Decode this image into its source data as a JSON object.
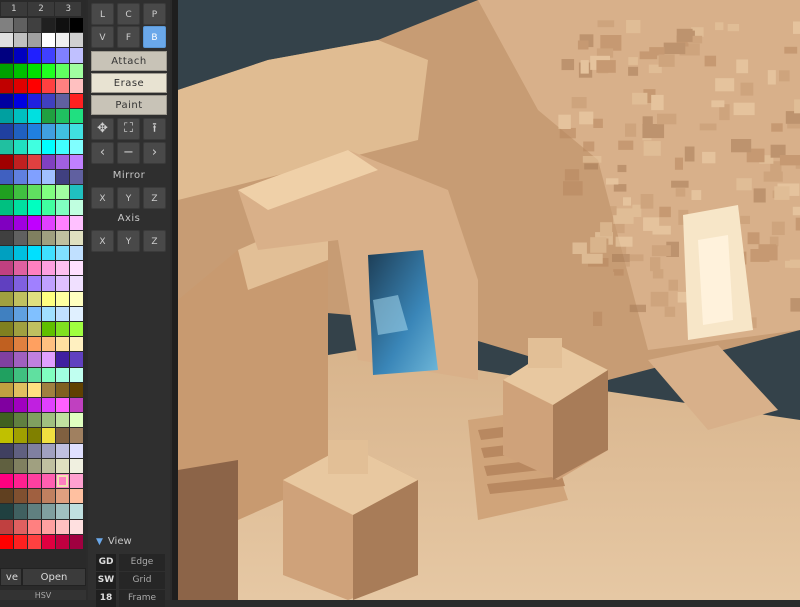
{
  "palette": {
    "tabs": [
      "1",
      "2",
      "3"
    ],
    "actions": {
      "save_label": "ve",
      "open_label": "Open"
    },
    "mode_label": "HSV",
    "columns": 6,
    "rows": 35,
    "selected_index": 184,
    "colors": [
      "#808080",
      "#606060",
      "#404040",
      "#202020",
      "#101010",
      "#000000",
      "#e0e0e0",
      "#c0c0c0",
      "#a0a0a0",
      "#ffffff",
      "#f0f0f0",
      "#d0d0d0",
      "#000080",
      "#0000c0",
      "#2020ff",
      "#4040ff",
      "#8080ff",
      "#c0c0ff",
      "#00a000",
      "#00c000",
      "#00e000",
      "#20ff20",
      "#60ff60",
      "#a0ffa0",
      "#c00000",
      "#e00000",
      "#ff0000",
      "#ff4040",
      "#ff8080",
      "#ffc0c0",
      "#0000a0",
      "#0000e0",
      "#2020e0",
      "#4040c0",
      "#6060a0",
      "#ff2020",
      "#00a0a0",
      "#00c0c0",
      "#00e0e0",
      "#20a040",
      "#20c060",
      "#20e080",
      "#2040a0",
      "#2060c0",
      "#2080e0",
      "#40a0e0",
      "#40c0e0",
      "#40e0e0",
      "#20c0a0",
      "#20e0c0",
      "#40ffe0",
      "#00ffff",
      "#40ffff",
      "#80ffff",
      "#a00000",
      "#c02020",
      "#e04040",
      "#8040c0",
      "#a060e0",
      "#c080ff",
      "#4060c0",
      "#6080e0",
      "#80a0ff",
      "#a0c0ff",
      "#404080",
      "#6060a0",
      "#20a020",
      "#40c040",
      "#60e060",
      "#80ff80",
      "#a0ffa0",
      "#20c0c0",
      "#00c080",
      "#00e0a0",
      "#00ffc0",
      "#40ffa0",
      "#80ffc0",
      "#c0ffe0",
      "#8000c0",
      "#a000e0",
      "#c000ff",
      "#e040ff",
      "#ff80ff",
      "#ffc0ff",
      "#404040",
      "#606060",
      "#808060",
      "#a0a080",
      "#c0c0a0",
      "#e0e0c0",
      "#00a0c0",
      "#00c0e0",
      "#00e0ff",
      "#40e0ff",
      "#80e0ff",
      "#c0e0ff",
      "#c04080",
      "#e060a0",
      "#ff80c0",
      "#ffa0e0",
      "#ffc0f0",
      "#ffe0ff",
      "#6040c0",
      "#8060e0",
      "#a080ff",
      "#c0a0ff",
      "#e0c0ff",
      "#f0e0ff",
      "#a0a040",
      "#c0c060",
      "#e0e080",
      "#ffff80",
      "#ffffa0",
      "#ffffc0",
      "#4080c0",
      "#60a0e0",
      "#80c0ff",
      "#a0e0ff",
      "#c0e0ff",
      "#e0f0ff",
      "#808020",
      "#a0a040",
      "#c0c060",
      "#60c000",
      "#80e020",
      "#a0ff40",
      "#c06020",
      "#e08040",
      "#ffa060",
      "#ffc080",
      "#ffe0a0",
      "#fff0c0",
      "#8040a0",
      "#a060c0",
      "#c080e0",
      "#e0a0ff",
      "#4020a0",
      "#6040c0",
      "#20a060",
      "#40c080",
      "#60e0a0",
      "#80ffc0",
      "#a0ffe0",
      "#c0fff0",
      "#c0a040",
      "#e0c060",
      "#ffe080",
      "#a08040",
      "#806020",
      "#604000",
      "#8000a0",
      "#a000c0",
      "#c020e0",
      "#e040ff",
      "#ff60ff",
      "#c040c0",
      "#406020",
      "#608040",
      "#80a060",
      "#a0c080",
      "#c0e0a0",
      "#e0ffc0",
      "#c0c000",
      "#a0a000",
      "#808000",
      "#f0e040",
      "#806040",
      "#a08060",
      "#404060",
      "#606080",
      "#8080a0",
      "#a0a0c0",
      "#c0c0e0",
      "#e0e0ff",
      "#606040",
      "#808060",
      "#a0a080",
      "#c0c0a0",
      "#e0e0c0",
      "#f0f0e0",
      "#ff0080",
      "#ff2090",
      "#ff40a0",
      "#ff60b0",
      "#ff80c0",
      "#ffa0d0",
      "#604020",
      "#805030",
      "#a06040",
      "#c08060",
      "#e0a080",
      "#ffc0a0",
      "#204040",
      "#406060",
      "#608080",
      "#80a0a0",
      "#a0c0c0",
      "#c0e0e0",
      "#c04040",
      "#e06060",
      "#ff8080",
      "#ffa0a0",
      "#ffc0c0",
      "#ffe0e0",
      "#ff0000",
      "#ff2020",
      "#ff4040",
      "#e00040",
      "#c00040",
      "#a00040",
      "#808080",
      "#a0a0a0",
      "#c0c0c0",
      "#e0e0e0",
      "#f0f0f0",
      "#ffffff",
      "#ff00c0",
      "#ff20d0",
      "#ff40e0",
      "#ff60f0",
      "#ff80ff",
      "#ffa0ff",
      "#e0e000",
      "#ffff00",
      "#ffff40",
      "#ffe020",
      "#ffc040",
      "#ffa060",
      "#ff60a0",
      "#ff80c0",
      "#ffa0e0",
      "#ffc0f0",
      "#ffe0f8",
      "#fff0fc",
      "#ffa040",
      "#ffc060",
      "#ffe080",
      "#fff0a0",
      "#ffffc0",
      "#ffffe0",
      "#303030",
      "#404040",
      "#505050",
      "#606060",
      "#707070",
      "#808080"
    ]
  },
  "tools": {
    "mode_buttons": [
      "L",
      "C",
      "P"
    ],
    "shape_buttons": [
      "V",
      "F",
      "B"
    ],
    "active_shape": "B",
    "actions": [
      {
        "label": "Attach",
        "active": false
      },
      {
        "label": "Erase",
        "active": true
      },
      {
        "label": "Paint",
        "active": false
      }
    ],
    "icon_row_1": [
      {
        "name": "move-icon",
        "glyph": "✥"
      },
      {
        "name": "select-box-icon",
        "glyph": "⛶"
      },
      {
        "name": "extrude-icon",
        "glyph": "⭱"
      }
    ],
    "icon_row_2": [
      {
        "name": "chevron-left-icon",
        "glyph": "‹"
      },
      {
        "name": "minus-icon",
        "glyph": "−"
      },
      {
        "name": "chevron-right-icon",
        "glyph": "›"
      }
    ],
    "mirror_label": "Mirror",
    "mirror_buttons": [
      "X",
      "Y",
      "Z"
    ],
    "axis_label": "Axis",
    "axis_buttons": [
      "X",
      "Y",
      "Z"
    ]
  },
  "view": {
    "label": "View",
    "rows": [
      {
        "key": "GD",
        "value": "Edge"
      },
      {
        "key": "SW",
        "value": "Grid"
      },
      {
        "key": "18",
        "value": "Frame"
      }
    ]
  },
  "viewport": {
    "colors": {
      "sky": "#34424a",
      "sand_light": "#e8c8a0",
      "sand_mid": "#d4aa80",
      "sand_dark": "#b88860",
      "shadow": "#8c6448",
      "doorway_blue": "#3a86b8",
      "doorway_dark": "#1d3d55"
    }
  }
}
